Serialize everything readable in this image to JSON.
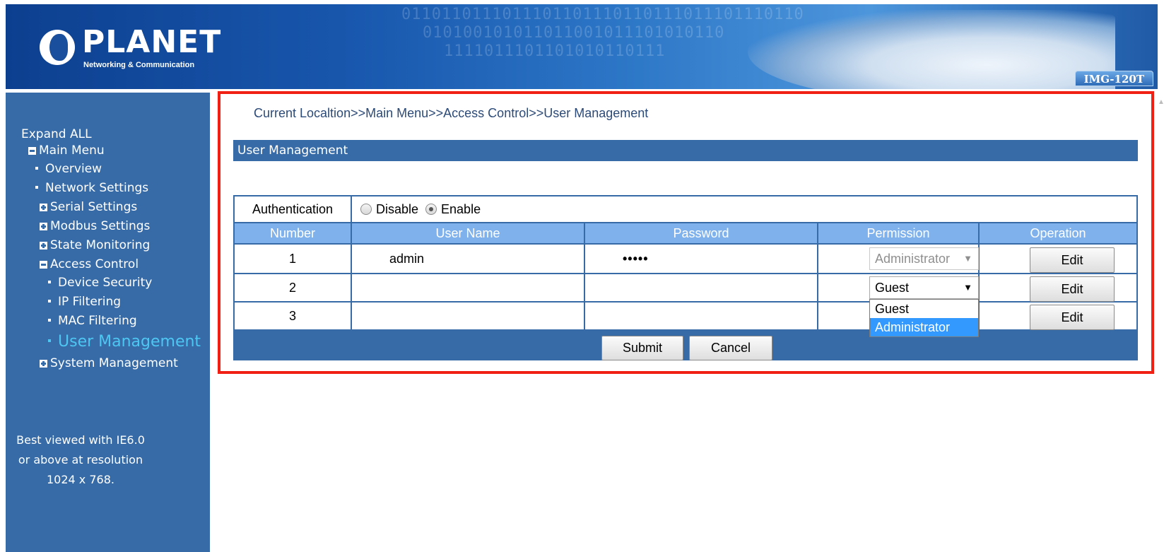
{
  "header": {
    "logo_name": "PLANET",
    "logo_tagline": "Networking & Communication",
    "model": "IMG-120T"
  },
  "sidebar": {
    "expand_all": "Expand ALL",
    "items": [
      {
        "label": "Main Menu",
        "kind": "minus"
      },
      {
        "label": "Overview",
        "kind": "dot"
      },
      {
        "label": "Network Settings",
        "kind": "dot"
      },
      {
        "label": "Serial Settings",
        "kind": "plus"
      },
      {
        "label": "Modbus Settings",
        "kind": "plus"
      },
      {
        "label": "State Monitoring",
        "kind": "plus"
      },
      {
        "label": "Access Control",
        "kind": "minus"
      },
      {
        "label": "Device Security",
        "kind": "dot"
      },
      {
        "label": "IP Filtering",
        "kind": "dot"
      },
      {
        "label": "MAC Filtering",
        "kind": "dot"
      },
      {
        "label": "User Management",
        "kind": "dot-active"
      },
      {
        "label": "System Management",
        "kind": "plus"
      }
    ],
    "note_lines": [
      "Best viewed with IE6.0",
      "or above at resolution",
      "1024 x 768."
    ]
  },
  "breadcrumb": "Current Localtion>>Main Menu>>Access Control>>User Management",
  "section_title": "User Management",
  "auth": {
    "label": "Authentication",
    "options": [
      "Disable",
      "Enable"
    ],
    "selected": "Enable"
  },
  "table": {
    "columns": [
      "Number",
      "User Name",
      "Password",
      "Permission",
      "Operation"
    ],
    "rows": [
      {
        "number": "1",
        "username": "admin",
        "password": "•••••",
        "permission": "Administrator",
        "permission_disabled": true,
        "operation": "Edit"
      },
      {
        "number": "2",
        "username": "",
        "password": "",
        "permission": "Guest",
        "permission_disabled": false,
        "operation": "Edit"
      },
      {
        "number": "3",
        "username": "",
        "password": "",
        "permission": "",
        "permission_disabled": false,
        "operation": "Edit"
      }
    ],
    "dropdown_options": [
      "Guest",
      "Administrator"
    ],
    "dropdown_highlight": "Administrator"
  },
  "actions": {
    "submit": "Submit",
    "cancel": "Cancel"
  },
  "colors": {
    "nav_bg": "#376ba7",
    "header_row": "#7fb2ec",
    "active_nav": "#4ec6f2",
    "highlight_border": "#f02014"
  },
  "icons": {
    "radio_off": "radio-unchecked-icon",
    "radio_on": "radio-checked-icon",
    "dropdown": "triangle-down-icon",
    "tree_expand": "plus-box-icon",
    "tree_collapse": "minus-box-icon"
  }
}
